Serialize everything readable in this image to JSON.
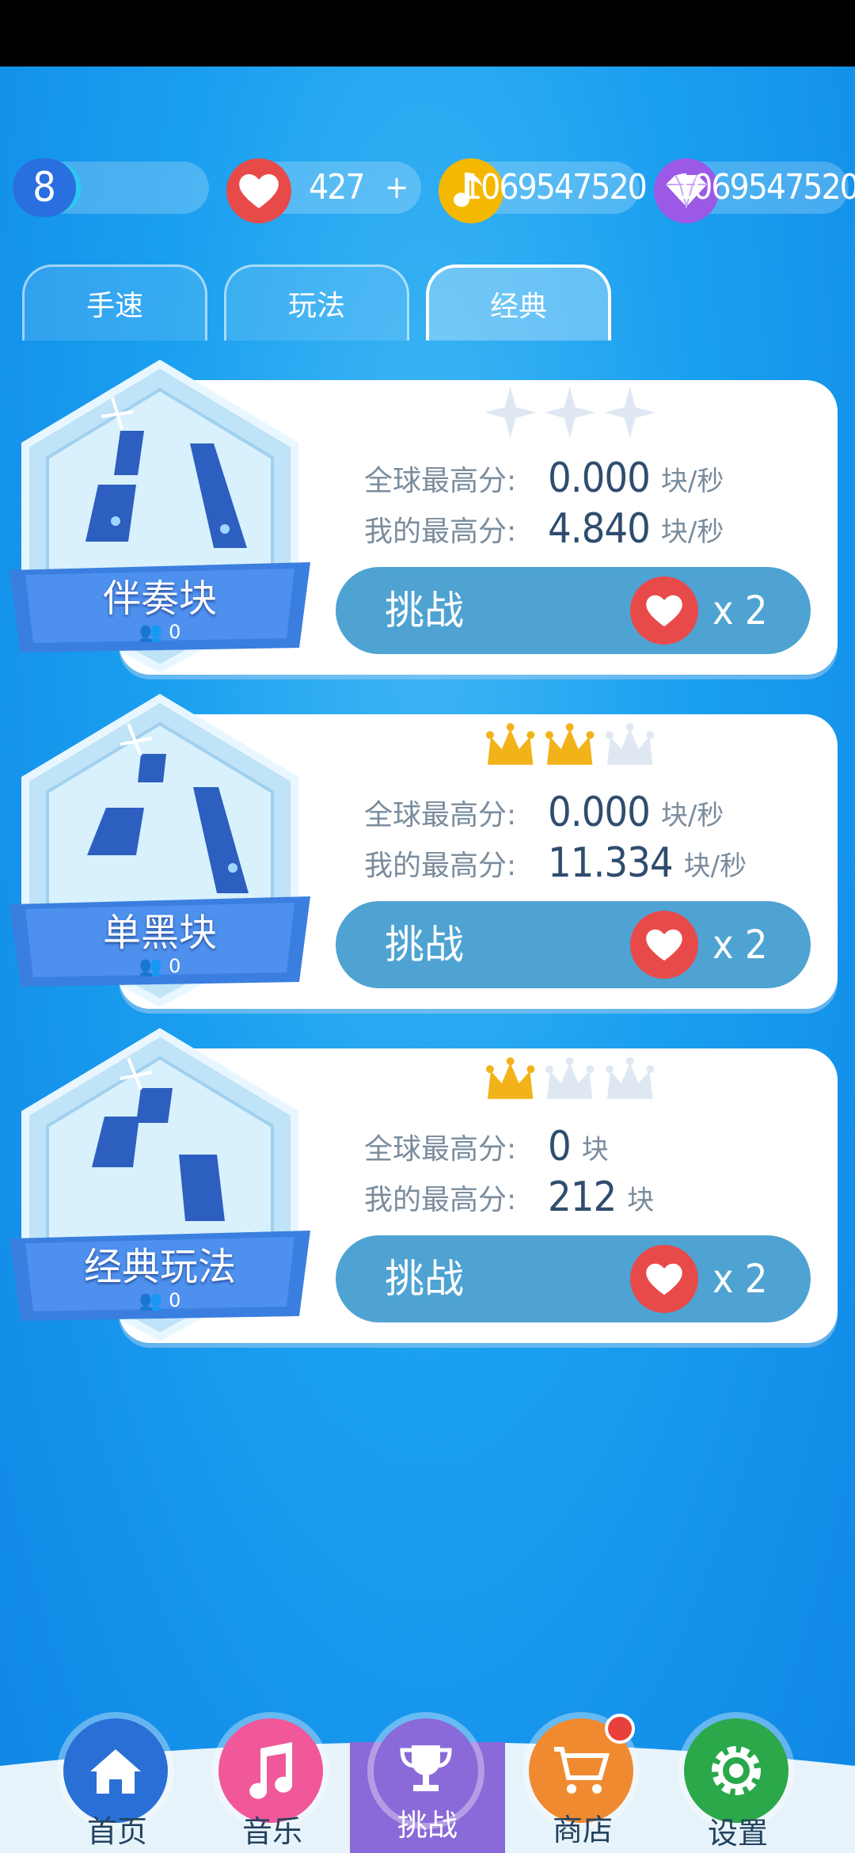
{
  "level": {
    "value": "8",
    "progress": 0.35
  },
  "resources": {
    "hearts": "427",
    "plus": "+",
    "notes": "1069547520",
    "diamonds": "1069547520"
  },
  "tabs": [
    {
      "label": "手速"
    },
    {
      "label": "玩法"
    },
    {
      "label": "经典",
      "active": true
    }
  ],
  "modes": [
    {
      "name": "伴奏块",
      "players": "0",
      "stars": "0 of 3",
      "global_label": "全球最高分:",
      "global_value": "0.000",
      "global_unit": "块/秒",
      "mine_label": "我的最高分:",
      "mine_value": "4.840",
      "mine_unit": "块/秒",
      "button": "挑战",
      "cost": "x 2"
    },
    {
      "name": "单黑块",
      "players": "0",
      "stars": "2 of 3",
      "global_label": "全球最高分:",
      "global_value": "0.000",
      "global_unit": "块/秒",
      "mine_label": "我的最高分:",
      "mine_value": "11.334",
      "mine_unit": "块/秒",
      "button": "挑战",
      "cost": "x 2"
    },
    {
      "name": "经典玩法",
      "players": "0",
      "stars": "1 of 3",
      "global_label": "全球最高分:",
      "global_value": "0",
      "global_unit": "块",
      "mine_label": "我的最高分:",
      "mine_value": "212",
      "mine_unit": "块",
      "button": "挑战",
      "cost": "x 2"
    }
  ],
  "nav": [
    {
      "label": "首页",
      "icon": "home-icon",
      "color": "#2a6fd6"
    },
    {
      "label": "音乐",
      "icon": "music-note-icon",
      "color": "#f0589a"
    },
    {
      "label": "挑战",
      "icon": "trophy-icon",
      "color": "#8a6ad8",
      "active": true
    },
    {
      "label": "商店",
      "icon": "cart-icon",
      "color": "#f08a30"
    },
    {
      "label": "设置",
      "icon": "gear-icon",
      "color": "#2aa84a"
    }
  ],
  "colors": {
    "heart": "#e84a4a",
    "note": "#f5b800",
    "diamond": "#9b59e6",
    "crown": "#f2b31a",
    "button": "#4ea3d2"
  }
}
